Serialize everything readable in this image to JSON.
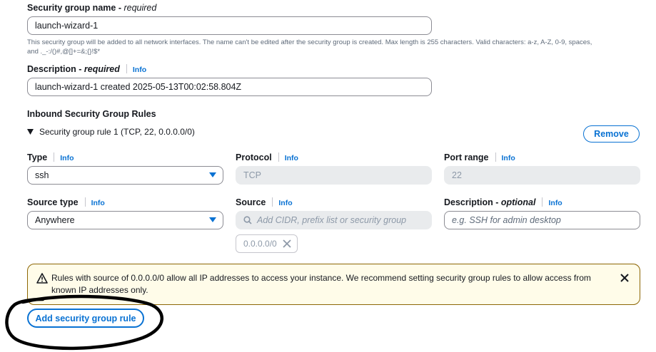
{
  "sg_name": {
    "label": "Security group name",
    "required_text": "required",
    "value": "launch-wizard-1",
    "helper_line1": "This security group will be added to all network interfaces. The name can't be edited after the security group is created. Max length is 255 characters. Valid characters: a-z, A-Z, 0-9, spaces,",
    "helper_line2": "and ._-:/()#,@[]+=&;{}!$*"
  },
  "description": {
    "label": "Description",
    "required_text": "required",
    "info": "Info",
    "value": "launch-wizard-1 created 2025-05-13T00:02:58.804Z"
  },
  "inbound": {
    "heading": "Inbound Security Group Rules",
    "rule_title": "Security group rule 1 (TCP, 22, 0.0.0.0/0)",
    "remove_label": "Remove",
    "type": {
      "label": "Type",
      "info": "Info",
      "value": "ssh"
    },
    "protocol": {
      "label": "Protocol",
      "info": "Info",
      "value": "TCP"
    },
    "port_range": {
      "label": "Port range",
      "info": "Info",
      "value": "22"
    },
    "source_type": {
      "label": "Source type",
      "info": "Info",
      "value": "Anywhere"
    },
    "source": {
      "label": "Source",
      "info": "Info",
      "placeholder": "Add CIDR, prefix list or security group",
      "token": "0.0.0.0/0"
    },
    "rule_description": {
      "label": "Description",
      "optional_text": "optional",
      "info": "Info",
      "placeholder": "e.g. SSH for admin desktop"
    }
  },
  "warning": {
    "line1": "Rules with source of 0.0.0.0/0 allow all IP addresses to access your instance. We recommend setting security group rules to allow access from",
    "line2": "known IP addresses only."
  },
  "add_rule_label": "Add security group rule",
  "colors": {
    "link": "#0972d3",
    "warning_border": "#8d6605",
    "warning_bg": "#fffce9",
    "annotation": "#000000"
  }
}
